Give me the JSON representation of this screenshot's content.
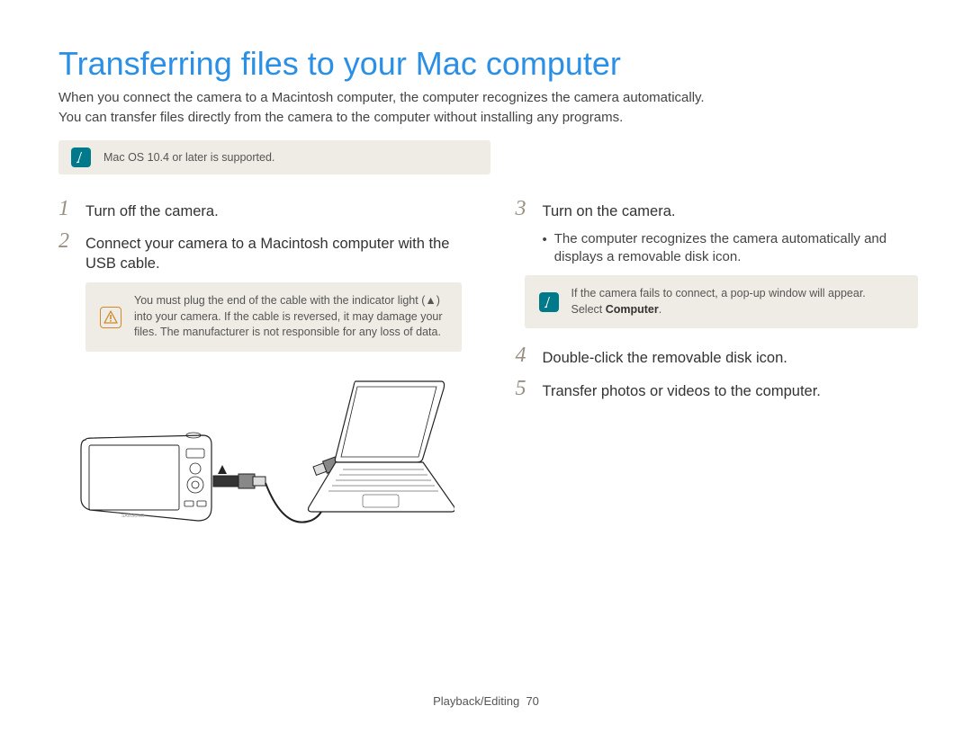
{
  "title": "Transferring files to your Mac computer",
  "intro_line1": "When you connect the camera to a Macintosh computer, the computer recognizes the camera automatically.",
  "intro_line2": "You can transfer files directly from the camera to the computer without installing any programs.",
  "note_top": "Mac OS 10.4 or later is supported.",
  "steps": {
    "s1": "Turn off the camera.",
    "s2": "Connect your camera to a Macintosh computer with the USB cable.",
    "s3": "Turn on the camera.",
    "s3_bullet": "The computer recognizes the camera automatically and displays a removable disk icon.",
    "s4": "Double-click the removable disk icon.",
    "s5": "Transfer photos or videos to the computer."
  },
  "warn_left": "You must plug the end of the cable with the indicator light (▲) into your camera. If the cable is reversed, it may damage your files. The manufacturer is not responsible for any loss of data.",
  "note_right_a": "If the camera fails to connect, a pop-up window will appear.",
  "note_right_b": "Select ",
  "note_right_b_bold": "Computer",
  "note_right_b_tail": ".",
  "footer_section": "Playback/Editing",
  "footer_page": "70"
}
